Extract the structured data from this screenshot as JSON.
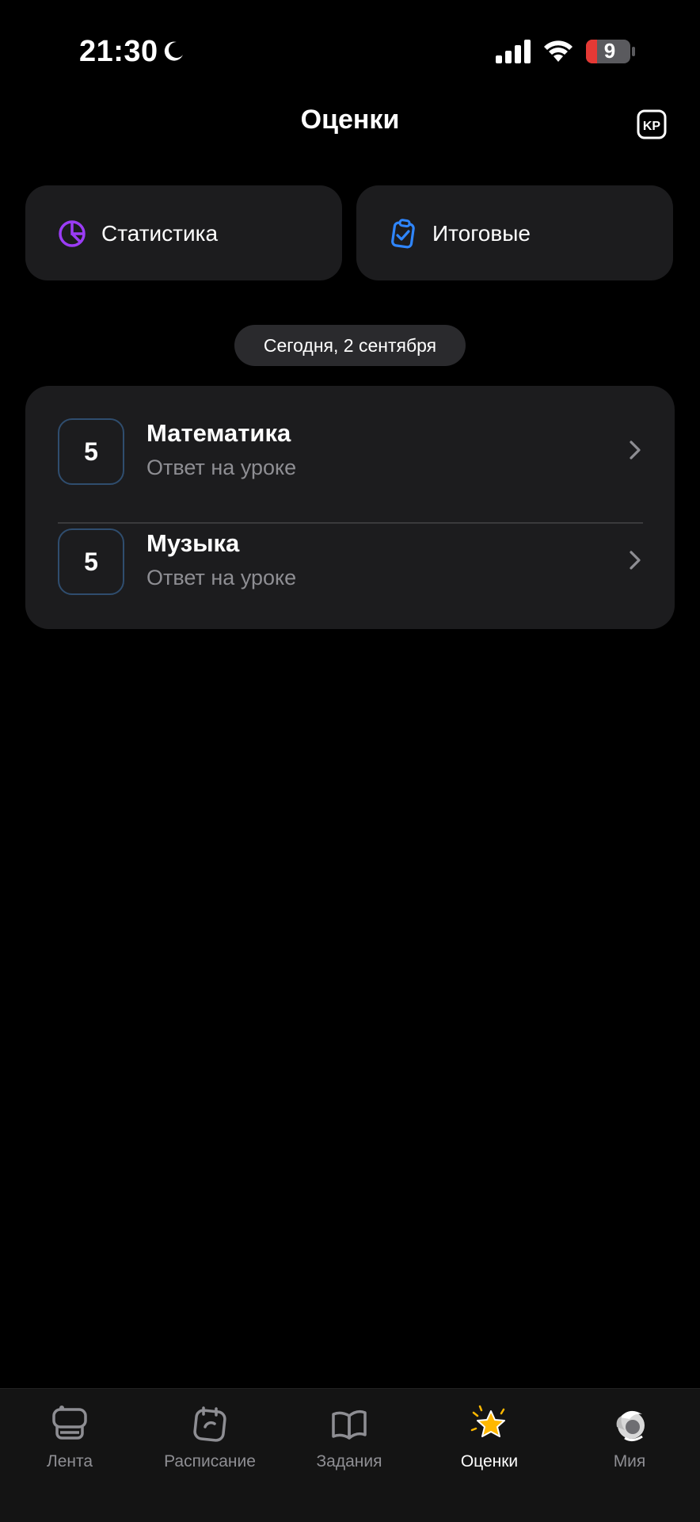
{
  "status_bar": {
    "time": "21:30",
    "battery": "9",
    "icons": [
      "moon-icon",
      "signal-icon",
      "wifi-icon",
      "battery-icon"
    ]
  },
  "header": {
    "title": "Оценки",
    "kp_icon": "kp-icon"
  },
  "quick_actions": [
    {
      "label": "Статистика",
      "icon": "pie-chart-icon",
      "icon_color": "#9b3cf5"
    },
    {
      "label": "Итоговые",
      "icon": "clipboard-check-icon",
      "icon_color": "#2f86ff"
    }
  ],
  "date_pill": "Сегодня, 2 сентября",
  "grades": [
    {
      "grade": "5",
      "subject": "Математика",
      "type": "Ответ на уроке"
    },
    {
      "grade": "5",
      "subject": "Музыка",
      "type": "Ответ на уроке"
    }
  ],
  "tabs": [
    {
      "label": "Лента",
      "icon": "feed-icon",
      "active": false
    },
    {
      "label": "Расписание",
      "icon": "calendar-icon",
      "active": false
    },
    {
      "label": "Задания",
      "icon": "book-icon",
      "active": false
    },
    {
      "label": "Оценки",
      "icon": "star-icon",
      "active": true
    },
    {
      "label": "Мия",
      "icon": "mia-avatar-icon",
      "active": false
    }
  ],
  "colors": {
    "background": "#000000",
    "card": "#1c1c1e",
    "grade_border": "#2f4d6e",
    "secondary_text": "#8e8e93",
    "active_tab_star": "#ffb800",
    "battery_low": "#e53935"
  }
}
